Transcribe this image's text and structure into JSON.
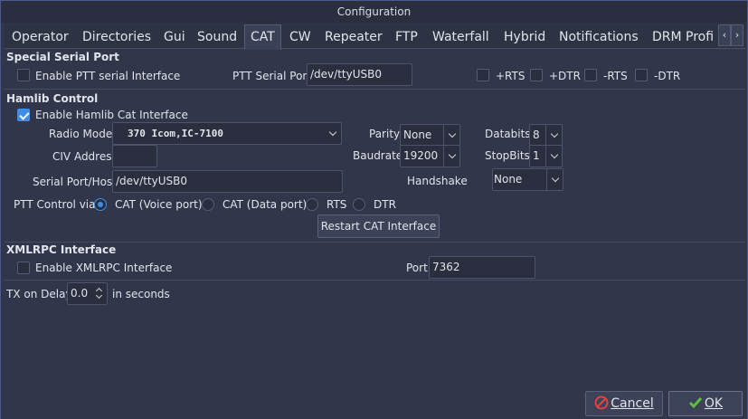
{
  "window": {
    "title": "Configuration"
  },
  "tabs": [
    {
      "label": "Operator"
    },
    {
      "label": "Directories"
    },
    {
      "label": "Gui"
    },
    {
      "label": "Sound"
    },
    {
      "label": "CAT"
    },
    {
      "label": "CW"
    },
    {
      "label": "Repeater"
    },
    {
      "label": "FTP"
    },
    {
      "label": "Waterfall"
    },
    {
      "label": "Hybrid"
    },
    {
      "label": "Notifications"
    },
    {
      "label": "DRM Profi"
    }
  ],
  "active_tab": "CAT",
  "serial_port": {
    "heading": "Special Serial Port",
    "enable_label": "Enable PTT serial Interface",
    "enable_checked": false,
    "port_label": "PTT Serial Port",
    "port_value": "/dev/ttyUSB0",
    "signals": [
      {
        "label": "+RTS",
        "checked": false
      },
      {
        "label": "+DTR",
        "checked": false
      },
      {
        "label": "-RTS",
        "checked": false
      },
      {
        "label": "-DTR",
        "checked": false
      }
    ]
  },
  "hamlib": {
    "heading": "Hamlib Control",
    "enable_label": "Enable Hamlib Cat Interface",
    "enable_checked": true,
    "radio_model_label": "Radio Model",
    "radio_model_value": "370 Icom,IC-7100",
    "civ_label": "CIV Address",
    "civ_value": "",
    "serial_host_label": "Serial Port/Host",
    "serial_host_value": "/dev/ttyUSB0",
    "parity_label": "Parity",
    "parity_value": "None",
    "baudrate_label": "Baudrate",
    "baudrate_value": "19200",
    "databits_label": "Databits",
    "databits_value": "8",
    "stopbits_label": "StopBits",
    "stopbits_value": "1",
    "handshake_label": "Handshake",
    "handshake_value": "None",
    "ptt_via_label": "PTT Control via:",
    "ptt_options": [
      {
        "label": "CAT (Voice port)",
        "checked": true
      },
      {
        "label": "CAT (Data port)",
        "checked": false
      },
      {
        "label": "RTS",
        "checked": false
      },
      {
        "label": "DTR",
        "checked": false
      }
    ],
    "restart_label": "Restart CAT Interface"
  },
  "xmlrpc": {
    "heading": "XMLRPC Interface",
    "enable_label": "Enable XMLRPC Interface",
    "enable_checked": false,
    "port_label": "Port",
    "port_value": "7362"
  },
  "tx_delay": {
    "label": "TX on Delay",
    "value": "0.0",
    "suffix": "in seconds"
  },
  "footer": {
    "cancel_label": "Cancel",
    "ok_label": "OK"
  },
  "colors": {
    "accent": "#3d8ee8",
    "cancel_icon": "#e8413c",
    "ok_icon": "#5fbf3f"
  }
}
